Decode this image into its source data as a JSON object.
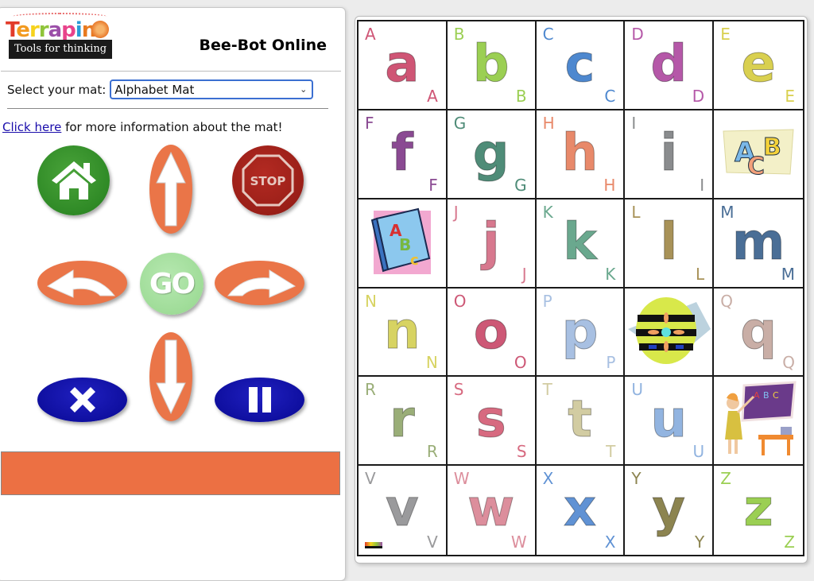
{
  "header": {
    "logo_word": [
      "T",
      "e",
      "r",
      "r",
      "a",
      "p",
      "i",
      "n",
      "*"
    ],
    "logo_tagline": "Tools for thinking",
    "title": "Bee-Bot Online"
  },
  "mat_selector": {
    "label": "Select your mat:",
    "selected": "Alphabet Mat"
  },
  "info": {
    "link_text": "Click here",
    "rest_text": " for more information about the mat!"
  },
  "controls": {
    "go_label": "GO",
    "stop_label": "STOP",
    "buttons": [
      "home",
      "forward",
      "stop",
      "turn-left",
      "go",
      "turn-right",
      "clear",
      "backward",
      "pause"
    ]
  },
  "program_bar": {
    "color": "#ec7043"
  },
  "mat": {
    "cells": [
      {
        "type": "letter",
        "upper": "A",
        "lower": "a",
        "color": "#cf5575"
      },
      {
        "type": "letter",
        "upper": "B",
        "lower": "b",
        "color": "#9bcf53"
      },
      {
        "type": "letter",
        "upper": "C",
        "lower": "c",
        "color": "#4e88cf"
      },
      {
        "type": "letter",
        "upper": "D",
        "lower": "d",
        "color": "#b558a8"
      },
      {
        "type": "letter",
        "upper": "E",
        "lower": "e",
        "color": "#d9d050"
      },
      {
        "type": "letter",
        "upper": "F",
        "lower": "f",
        "color": "#8a4a92"
      },
      {
        "type": "letter",
        "upper": "G",
        "lower": "g",
        "color": "#4f8c78"
      },
      {
        "type": "letter",
        "upper": "H",
        "lower": "h",
        "color": "#e8896a"
      },
      {
        "type": "letter",
        "upper": "I",
        "lower": "i",
        "color": "#8a8c8e"
      },
      {
        "type": "picture",
        "name": "abc-letters-clipart"
      },
      {
        "type": "picture",
        "name": "abc-book-clipart"
      },
      {
        "type": "letter",
        "upper": "J",
        "lower": "j",
        "color": "#d7788e"
      },
      {
        "type": "letter",
        "upper": "K",
        "lower": "k",
        "color": "#6aa88e"
      },
      {
        "type": "letter",
        "upper": "L",
        "lower": "l",
        "color": "#a89258"
      },
      {
        "type": "letter",
        "upper": "M",
        "lower": "m",
        "color": "#4a6e96"
      },
      {
        "type": "letter",
        "upper": "N",
        "lower": "n",
        "color": "#d7d362"
      },
      {
        "type": "letter",
        "upper": "O",
        "lower": "o",
        "color": "#cd5876"
      },
      {
        "type": "letter",
        "upper": "P",
        "lower": "p",
        "color": "#a8c0e2"
      },
      {
        "type": "picture",
        "name": "bee-bot-robot"
      },
      {
        "type": "letter",
        "upper": "Q",
        "lower": "q",
        "color": "#c9aea6"
      },
      {
        "type": "letter",
        "upper": "R",
        "lower": "r",
        "color": "#9aae78"
      },
      {
        "type": "letter",
        "upper": "S",
        "lower": "s",
        "color": "#d76a80"
      },
      {
        "type": "letter",
        "upper": "T",
        "lower": "t",
        "color": "#d2cca2"
      },
      {
        "type": "letter",
        "upper": "U",
        "lower": "u",
        "color": "#92b4e0"
      },
      {
        "type": "picture",
        "name": "teacher-chalkboard-clipart"
      },
      {
        "type": "letter",
        "upper": "V",
        "lower": "v",
        "color": "#9a9a9c"
      },
      {
        "type": "letter",
        "upper": "W",
        "lower": "w",
        "color": "#dc8e9c"
      },
      {
        "type": "letter",
        "upper": "X",
        "lower": "x",
        "color": "#6092d4"
      },
      {
        "type": "letter",
        "upper": "Y",
        "lower": "y",
        "color": "#8c8450"
      },
      {
        "type": "letter",
        "upper": "Z",
        "lower": "z",
        "color": "#9bcf53"
      }
    ]
  }
}
